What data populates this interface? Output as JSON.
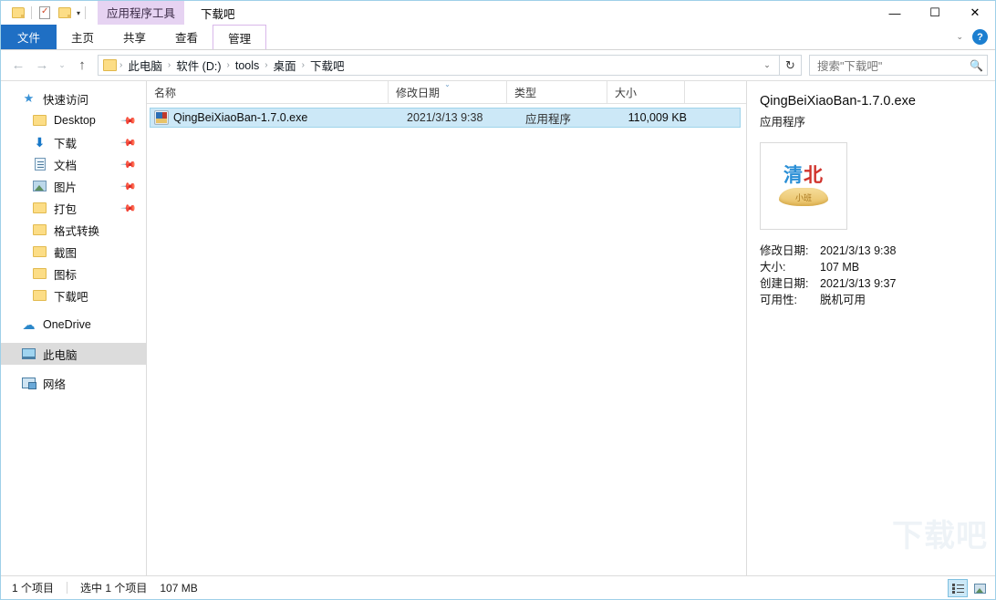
{
  "window": {
    "title": "下载吧",
    "contextual_tab": "应用程序工具",
    "minimize": "—",
    "maximize": "☐",
    "close": "✕"
  },
  "quick_access_toolbar": {
    "items": [
      {
        "name": "folder-icon",
        "label": ""
      },
      {
        "name": "properties-icon",
        "label": ""
      },
      {
        "name": "new-folder-icon",
        "label": ""
      },
      {
        "name": "customize-caret",
        "label": "▾"
      }
    ]
  },
  "ribbon": {
    "tabs": [
      {
        "label": "文件",
        "active": true
      },
      {
        "label": "主页",
        "active": false
      },
      {
        "label": "共享",
        "active": false
      },
      {
        "label": "查看",
        "active": false
      },
      {
        "label": "管理",
        "active": false,
        "contextual": true
      }
    ],
    "collapse_caret": "⌄",
    "help_label": "?"
  },
  "address_bar": {
    "back": "←",
    "forward": "→",
    "recent": "⌄",
    "up": "↑",
    "crumbs": [
      "此电脑",
      "软件 (D:)",
      "tools",
      "桌面",
      "下载吧"
    ],
    "separator": "›",
    "dropdown": "⌄",
    "refresh": "↻"
  },
  "search": {
    "placeholder": "搜索\"下载吧\"",
    "icon": "search-icon"
  },
  "sidebar": {
    "items": [
      {
        "label": "快速访问",
        "icon": "star-icon",
        "level": 0,
        "pinned": false,
        "selected": false
      },
      {
        "label": "Desktop",
        "icon": "folder-icon",
        "level": 1,
        "pinned": true,
        "selected": false
      },
      {
        "label": "下载",
        "icon": "download-icon",
        "level": 1,
        "pinned": true,
        "selected": false
      },
      {
        "label": "文档",
        "icon": "document-icon",
        "level": 1,
        "pinned": true,
        "selected": false
      },
      {
        "label": "图片",
        "icon": "pictures-icon",
        "level": 1,
        "pinned": true,
        "selected": false
      },
      {
        "label": "打包",
        "icon": "folder-icon",
        "level": 1,
        "pinned": true,
        "selected": false
      },
      {
        "label": "格式转换",
        "icon": "folder-icon",
        "level": 1,
        "pinned": false,
        "selected": false
      },
      {
        "label": "截图",
        "icon": "folder-icon",
        "level": 1,
        "pinned": false,
        "selected": false
      },
      {
        "label": "图标",
        "icon": "folder-icon",
        "level": 1,
        "pinned": false,
        "selected": false
      },
      {
        "label": "下载吧",
        "icon": "folder-icon",
        "level": 1,
        "pinned": false,
        "selected": false
      },
      {
        "label": "OneDrive",
        "icon": "cloud-icon",
        "level": 0,
        "pinned": false,
        "selected": false
      },
      {
        "label": "此电脑",
        "icon": "computer-icon",
        "level": 0,
        "pinned": false,
        "selected": true
      },
      {
        "label": "网络",
        "icon": "network-icon",
        "level": 0,
        "pinned": false,
        "selected": false
      }
    ]
  },
  "file_list": {
    "columns": [
      {
        "label": "名称",
        "sorted": false
      },
      {
        "label": "修改日期",
        "sorted": true
      },
      {
        "label": "类型",
        "sorted": false
      },
      {
        "label": "大小",
        "sorted": false
      }
    ],
    "sort_indicator": "⌄",
    "rows": [
      {
        "name": "QingBeiXiaoBan-1.7.0.exe",
        "date": "2021/3/13 9:38",
        "type": "应用程序",
        "size": "110,009 KB",
        "icon": "executable-icon",
        "selected": true
      }
    ]
  },
  "details_pane": {
    "title": "QingBeiXiaoBan-1.7.0.exe",
    "subtitle": "应用程序",
    "thumbnail": {
      "text_left": "清",
      "text_right": "北",
      "badge": "小班"
    },
    "fields": [
      {
        "key": "修改日期:",
        "value": "2021/3/13 9:38"
      },
      {
        "key": "大小:",
        "value": "107 MB"
      },
      {
        "key": "创建日期:",
        "value": "2021/3/13 9:37"
      },
      {
        "key": "可用性:",
        "value": "脱机可用"
      }
    ]
  },
  "status_bar": {
    "item_count": "1 个项目",
    "selection": "选中 1 个项目",
    "selection_size": "107 MB",
    "view_buttons": [
      {
        "name": "details-view-button",
        "active": true
      },
      {
        "name": "large-icons-view-button",
        "active": false
      }
    ]
  },
  "watermark": {
    "text": "下载吧"
  }
}
